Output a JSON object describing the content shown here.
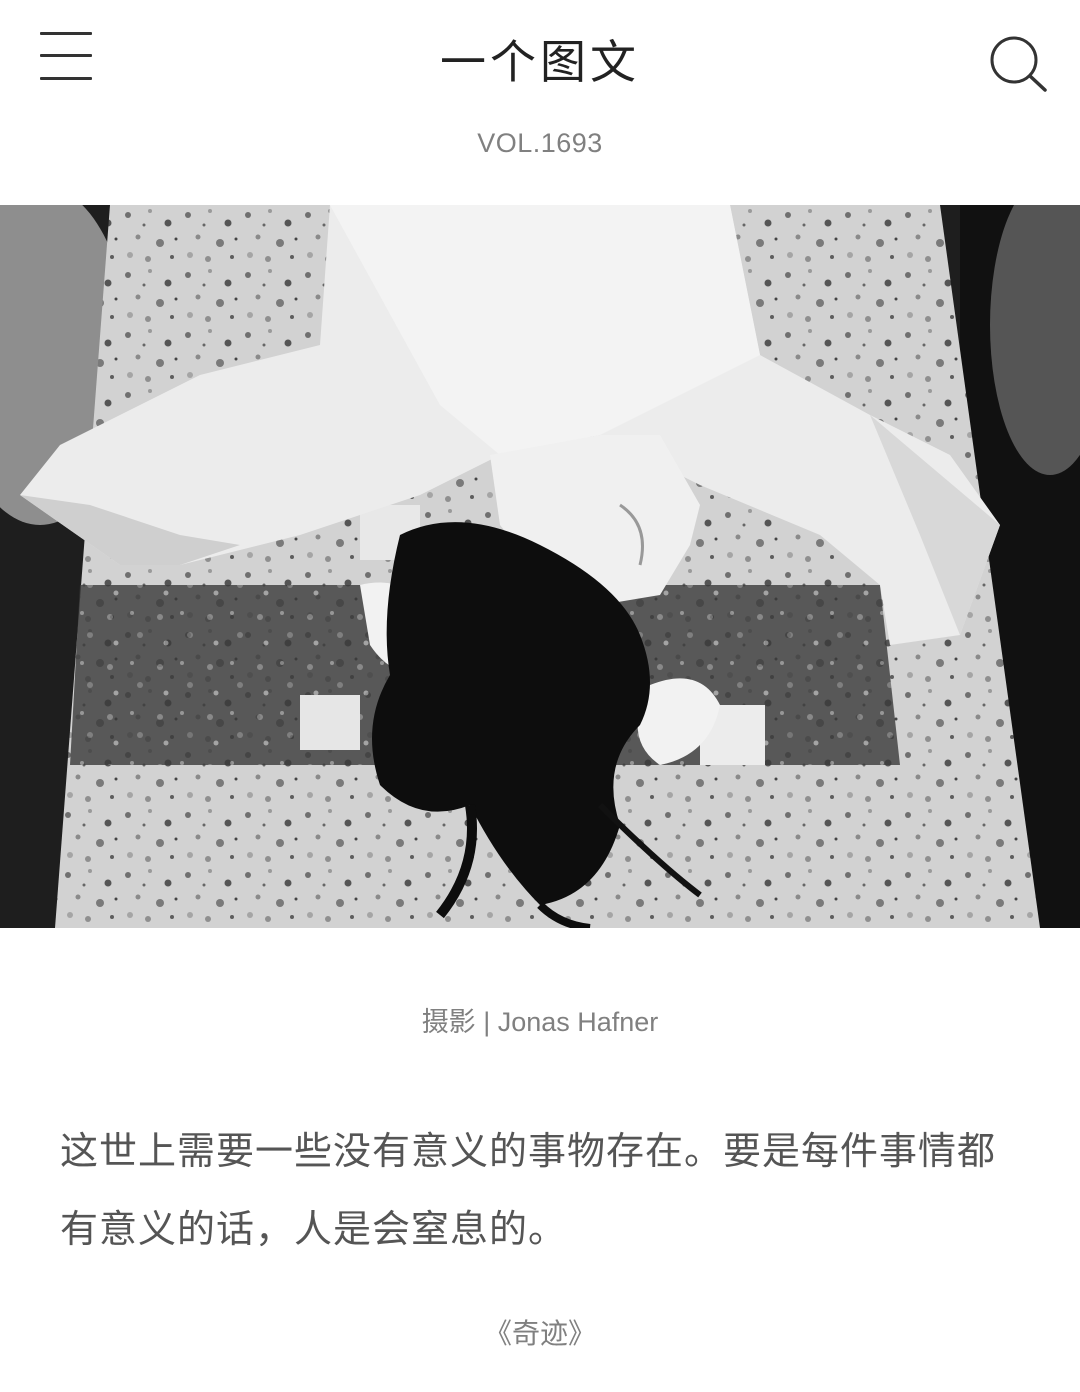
{
  "header": {
    "menu_icon": "hamburger-menu-icon",
    "title": "一个图文",
    "search_icon": "search-icon"
  },
  "volume": "VOL.1693",
  "photo": {
    "kind": "black-and-white photograph of a person lying on a terrazzo surface"
  },
  "credit": "摄影 | Jonas Hafner",
  "quote": "这世上需要一些没有意义的事物存在。要是每件事情都有意义的话，人是会窒息的。",
  "source": "《奇迹》"
}
